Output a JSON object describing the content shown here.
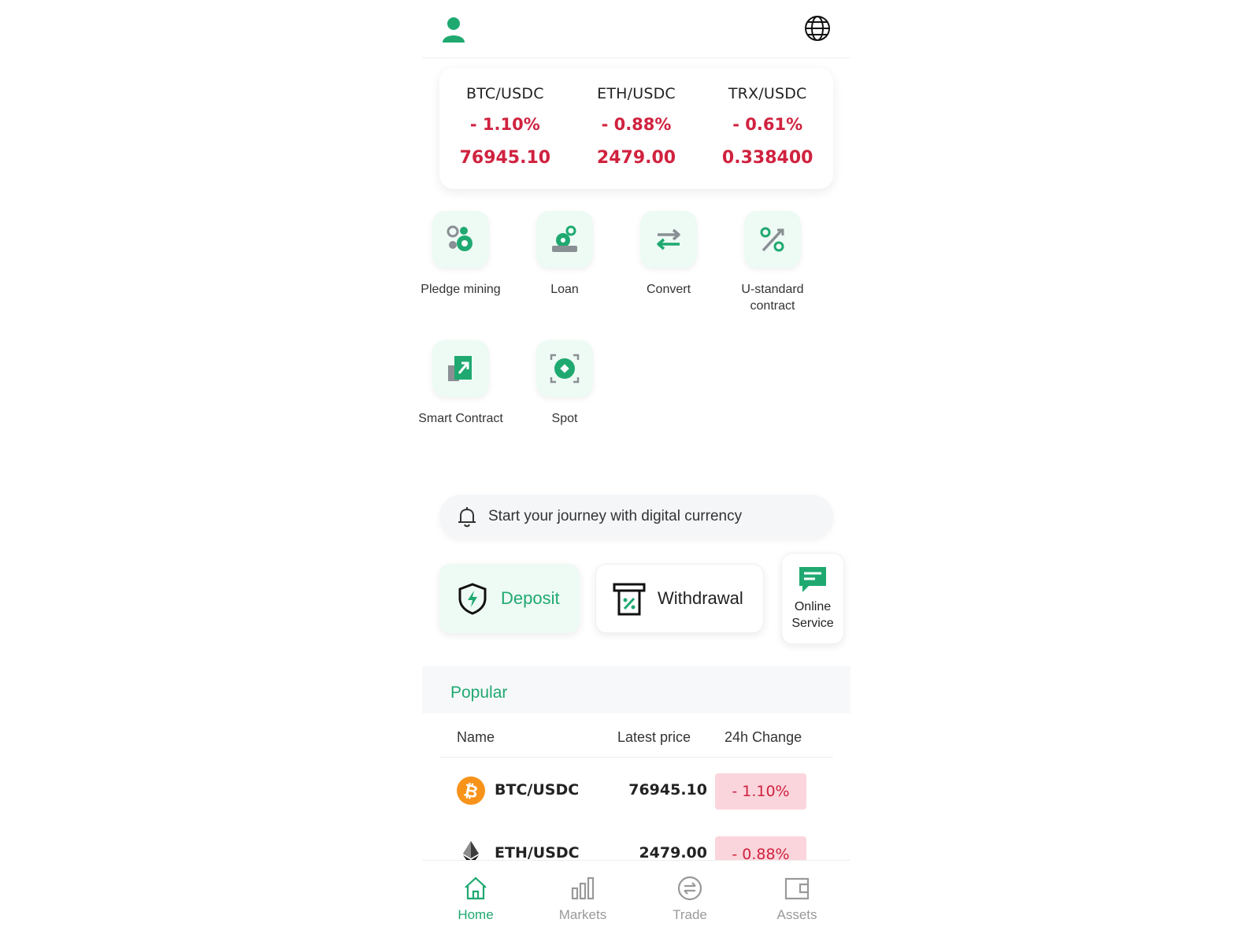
{
  "ticker": [
    {
      "pair": "BTC/USDC",
      "change": "- 1.10%",
      "price": "76945.10"
    },
    {
      "pair": "ETH/USDC",
      "change": "- 0.88%",
      "price": "2479.00"
    },
    {
      "pair": "TRX/USDC",
      "change": "- 0.61%",
      "price": "0.338400"
    }
  ],
  "features": [
    {
      "label": "Pledge mining",
      "icon": "pledge-mining-icon"
    },
    {
      "label": "Loan",
      "icon": "loan-icon"
    },
    {
      "label": "Convert",
      "icon": "convert-arrows-icon"
    },
    {
      "label": "U-standard contract",
      "icon": "percent-icon"
    },
    {
      "label": "Smart Contract",
      "icon": "smart-contract-icon"
    },
    {
      "label": "Spot",
      "icon": "spot-icon"
    }
  ],
  "notice": {
    "text": "Start your journey with digital currency",
    "icon": "bell-icon"
  },
  "actions": {
    "deposit": "Deposit",
    "withdrawal": "Withdrawal",
    "service_line1": "Online",
    "service_line2": "Service"
  },
  "popular": {
    "title": "Popular",
    "columns": {
      "name": "Name",
      "price": "Latest price",
      "change": "24h Change"
    },
    "rows": [
      {
        "pair": "BTC/USDC",
        "price": "76945.10",
        "change": "- 1.10%",
        "icon": "bitcoin-icon"
      },
      {
        "pair": "ETH/USDC",
        "price": "2479.00",
        "change": "- 0.88%",
        "icon": "ethereum-icon"
      }
    ]
  },
  "nav": [
    {
      "label": "Home",
      "icon": "home-icon",
      "active": true
    },
    {
      "label": "Markets",
      "icon": "bar-chart-icon",
      "active": false
    },
    {
      "label": "Trade",
      "icon": "trade-icon",
      "active": false
    },
    {
      "label": "Assets",
      "icon": "wallet-icon",
      "active": false
    }
  ],
  "colors": {
    "accent": "#1fa971",
    "negative": "#d0223f",
    "negative_bg": "#fbd5dc"
  }
}
